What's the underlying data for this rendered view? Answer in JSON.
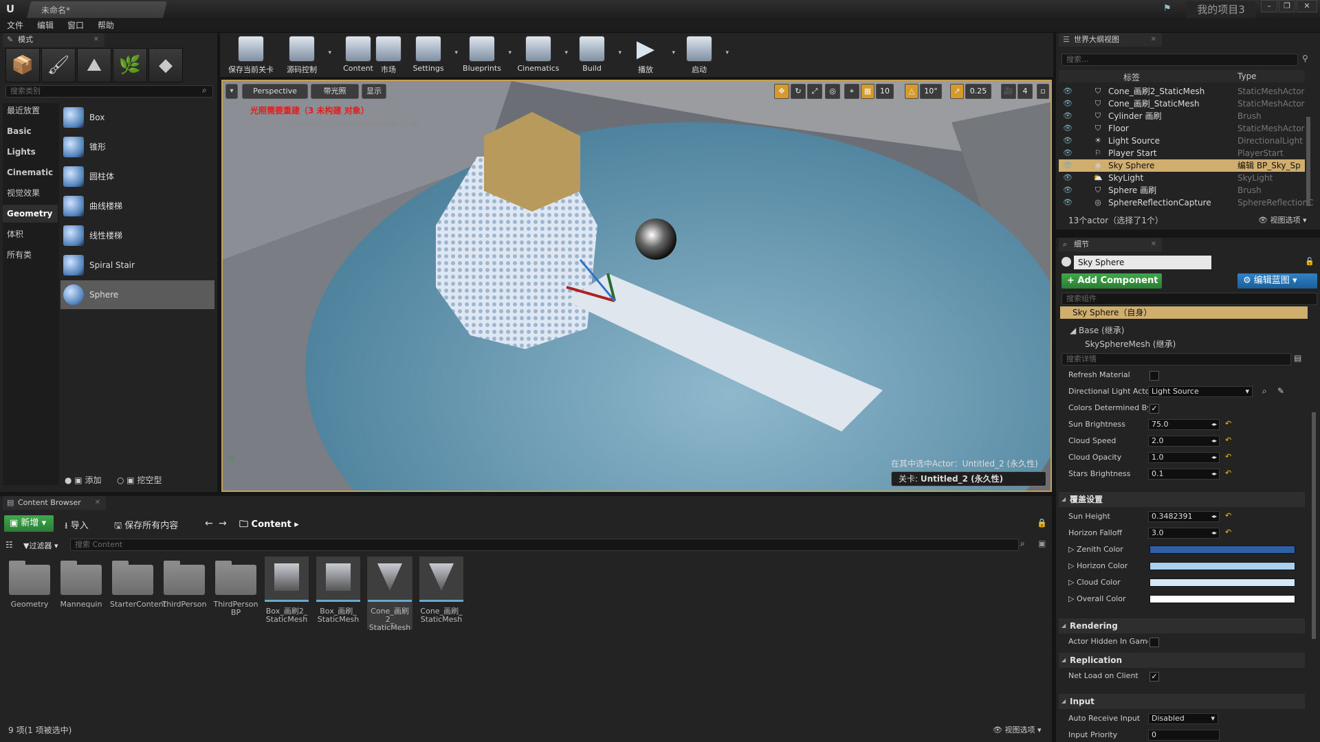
{
  "title_bar": {
    "doc_tab": "未命名*",
    "project": "我的项目3",
    "buttons": [
      "–",
      "❐",
      "✕"
    ]
  },
  "menu": [
    "文件",
    "编辑",
    "窗口",
    "帮助"
  ],
  "modes": {
    "tab": "模式",
    "mode_icons": [
      "place-mode-icon",
      "paint-mode-icon",
      "landscape-mode-icon",
      "foliage-mode-icon",
      "geometry-edit-mode-icon"
    ],
    "search_placeholder": "搜索类别",
    "categories": [
      "最近放置",
      "Basic",
      "Lights",
      "Cinematic",
      "视觉效果",
      "Geometry",
      "体积",
      "所有类"
    ],
    "selected_category": "Geometry",
    "items": [
      "Box",
      "锥形",
      "圆柱体",
      "曲线楼梯",
      "线性楼梯",
      "Spiral Stair",
      "Sphere"
    ],
    "selected_item": "Sphere",
    "footer": {
      "add": "添加",
      "subtract": "挖空型"
    }
  },
  "toolbar": [
    {
      "label": "保存当前关卡",
      "icon": "save-icon",
      "arrow": false
    },
    {
      "label": "源码控制",
      "icon": "source-control-icon",
      "arrow": true
    },
    {
      "label": "Content",
      "icon": "content-icon",
      "arrow": false
    },
    {
      "label": "市场",
      "icon": "marketplace-icon",
      "arrow": false
    },
    {
      "label": "Settings",
      "icon": "settings-icon",
      "arrow": true
    },
    {
      "label": "Blueprints",
      "icon": "blueprints-icon",
      "arrow": true
    },
    {
      "label": "Cinematics",
      "icon": "cinematics-icon",
      "arrow": true
    },
    {
      "label": "Build",
      "icon": "build-icon",
      "arrow": true
    },
    {
      "label": "播放",
      "icon": "play-icon",
      "arrow": true
    },
    {
      "label": "启动",
      "icon": "launch-icon",
      "arrow": true
    }
  ],
  "viewport": {
    "perspective": "Perspective",
    "lit": "带光照",
    "show": "显示",
    "warning": "光照需要重建（3 未构建 对象）",
    "warning_sub": "DisableAllScreenMessages进行抑制",
    "snap_grid": "10",
    "snap_rot": "10°",
    "snap_scale": "0.25",
    "cam_speed": "4",
    "actor_info": "在其中选中Actor：Untitled_2 (永久性)",
    "level_label": "关卡:",
    "level_name": "Untitled_2 (永久性)"
  },
  "outliner": {
    "tab": "世界大纲视图",
    "search_placeholder": "搜索...",
    "col_label": "标签",
    "col_type": "Type",
    "rows": [
      {
        "name": "Cone_画刷2_StaticMesh",
        "type": "StaticMeshActor"
      },
      {
        "name": "Cone_画刷_StaticMesh",
        "type": "StaticMeshActor"
      },
      {
        "name": "Cylinder 画刷",
        "type": "Brush"
      },
      {
        "name": "Floor",
        "type": "StaticMeshActor"
      },
      {
        "name": "Light Source",
        "type": "DirectionalLight"
      },
      {
        "name": "Player Start",
        "type": "PlayerStart"
      },
      {
        "name": "Sky Sphere",
        "type": "编辑 BP_Sky_Sp"
      },
      {
        "name": "SkyLight",
        "type": "SkyLight"
      },
      {
        "name": "Sphere 画刷",
        "type": "Brush"
      },
      {
        "name": "SphereReflectionCapture",
        "type": "SphereReflectionC"
      }
    ],
    "selected_index": 6,
    "footer": "13个actor（选择了1个）",
    "view_options": "视图选项"
  },
  "details": {
    "tab": "细节",
    "name": "Sky Sphere",
    "add_component": "Add Component",
    "edit_bp": "编辑蓝图",
    "component_search": "搜索组件",
    "self": "Sky Sphere（自身）",
    "base": "Base (继承)",
    "mesh": "SkySphereMesh (继承)",
    "detail_search": "搜索详情",
    "refresh_material": "Refresh Material",
    "dir_light_label": "Directional Light Actor",
    "dir_light_value": "Light Source",
    "colors_determined": "Colors Determined By",
    "props": [
      {
        "name": "Sun Brightness",
        "value": "75.0"
      },
      {
        "name": "Cloud Speed",
        "value": "2.0"
      },
      {
        "name": "Cloud Opacity",
        "value": "1.0"
      },
      {
        "name": "Stars Brightness",
        "value": "0.1"
      }
    ],
    "override_section": "覆盖设置",
    "override_props": [
      {
        "name": "Sun Height",
        "value": "0.3482391"
      },
      {
        "name": "Horizon Falloff",
        "value": "3.0"
      }
    ],
    "colors": [
      {
        "name": "Zenith Color",
        "color": "#2f5fa8"
      },
      {
        "name": "Horizon Color",
        "color": "#a9d0ef"
      },
      {
        "name": "Cloud Color",
        "color": "#d6e8f6"
      },
      {
        "name": "Overall Color",
        "color": "#ffffff"
      }
    ],
    "rendering": "Rendering",
    "actor_hidden": "Actor Hidden In Game",
    "replication": "Replication",
    "net_load": "Net Load on Client",
    "input": "Input",
    "auto_receive": "Auto Receive Input",
    "auto_receive_value": "Disabled",
    "input_priority": "Input Priority",
    "input_priority_value": "0"
  },
  "content_browser": {
    "tab": "Content Browser",
    "new": "新增",
    "import": "导入",
    "save_all": "保存所有内容",
    "path": "Content",
    "filter": "过滤器",
    "search_placeholder": "搜索 Content",
    "folders": [
      "Geometry",
      "Mannequin",
      "StarterContent",
      "ThirdPerson",
      "ThirdPerson BP"
    ],
    "assets": [
      {
        "label": "Box_画刷2_ StaticMesh"
      },
      {
        "label": "Box_画刷_ StaticMesh"
      },
      {
        "label": "Cone_画刷2_ StaticMesh"
      },
      {
        "label": "Cone_画刷_ StaticMesh"
      }
    ],
    "status": "9 项(1 项被选中)",
    "view_options": "视图选项"
  }
}
